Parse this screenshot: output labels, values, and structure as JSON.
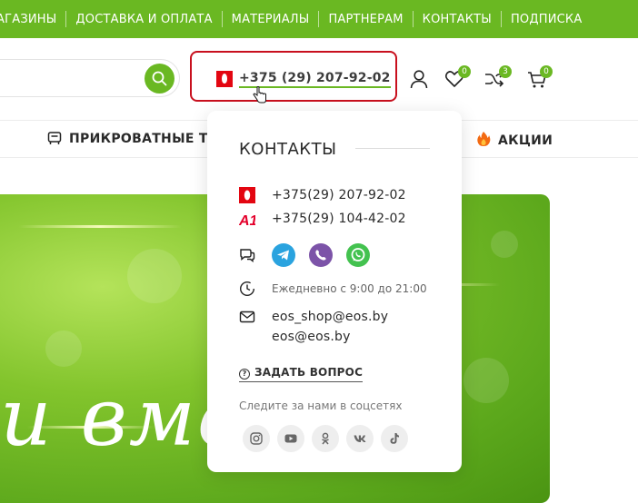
{
  "topnav": {
    "items": [
      "АГАЗИНЫ",
      "ДОСТАВКА И ОПЛАТА",
      "МАТЕРИАЛЫ",
      "ПАРТНЕРАМ",
      "КОНТАКТЫ",
      "ПОДПИСКА"
    ]
  },
  "header": {
    "phone": "+375 (29) 207-92-02",
    "wishlist_count": "0",
    "compare_count": "3",
    "cart_count": "0"
  },
  "categories": {
    "bedside": "ПРИКРОВАТНЫЕ ТУ",
    "sales": "АКЦИИ"
  },
  "banner": {
    "text": "и вме"
  },
  "contacts": {
    "title": "КОНТАКТЫ",
    "phone_mts": "+375(29) 207-92-02",
    "phone_a1": "+375(29) 104-42-02",
    "hours": "Ежедневно с 9:00 до 21:00",
    "email1": "eos_shop@eos.by",
    "email2": "eos@eos.by",
    "ask": "ЗАДАТЬ ВОПРОС",
    "follow": "Следите за нами в соцсетях",
    "a1_logo": "A1"
  },
  "colors": {
    "brand_green": "#6ab822",
    "mts_red": "#e30611",
    "highlight_red": "#c8101e",
    "telegram": "#2aa3df",
    "viber": "#7c53a8",
    "whatsapp": "#43c24f"
  }
}
